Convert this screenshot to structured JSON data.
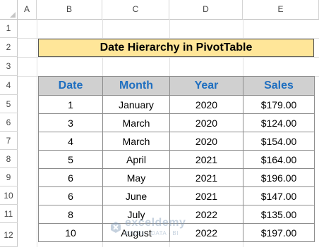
{
  "columns": [
    "A",
    "B",
    "C",
    "D",
    "E"
  ],
  "rows": [
    "1",
    "2",
    "3",
    "4",
    "5",
    "6",
    "7",
    "8",
    "9",
    "10",
    "11",
    "12"
  ],
  "title": "Date Hierarchy in PivotTable",
  "table": {
    "headers": [
      "Date",
      "Month",
      "Year",
      "Sales"
    ],
    "rows": [
      [
        "1",
        "January",
        "2020",
        "$179.00"
      ],
      [
        "3",
        "March",
        "2020",
        "$124.00"
      ],
      [
        "4",
        "March",
        "2020",
        "$154.00"
      ],
      [
        "5",
        "April",
        "2021",
        "$164.00"
      ],
      [
        "6",
        "May",
        "2021",
        "$196.00"
      ],
      [
        "6",
        "June",
        "2021",
        "$147.00"
      ],
      [
        "8",
        "July",
        "2022",
        "$135.00"
      ],
      [
        "10",
        "August",
        "2022",
        "$197.00"
      ]
    ]
  },
  "watermark": {
    "name": "exceldemy",
    "tagline": "EXCEL · DATA · BI"
  },
  "colors": {
    "title_fill": "#ffe699",
    "header_fill": "#d0d0d0",
    "header_text": "#1f6fc0"
  }
}
